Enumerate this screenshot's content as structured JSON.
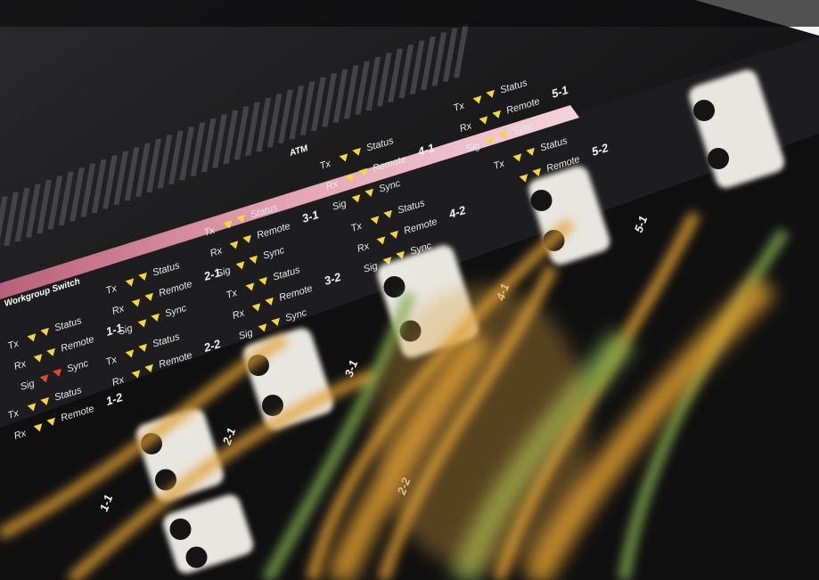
{
  "photo": {
    "subject_labels": {
      "switch_name": "Workgroup Switch",
      "atm": "ATM"
    },
    "port_groups": [
      {
        "id": "1-1",
        "rows": [
          "Status",
          "Remote",
          "Sync"
        ],
        "side": [
          "Tx",
          "Rx",
          "Sig"
        ]
      },
      {
        "id": "1-2",
        "rows": [
          "Status",
          "Remote"
        ],
        "side": [
          "Tx",
          "Rx"
        ]
      },
      {
        "id": "2-1",
        "rows": [
          "Status",
          "Remote",
          "Sync"
        ],
        "side": [
          "Tx",
          "Rx",
          "Sig"
        ]
      },
      {
        "id": "2-2",
        "rows": [
          "Status",
          "Remote"
        ],
        "side": [
          "Tx",
          "Rx"
        ]
      },
      {
        "id": "3-1",
        "rows": [
          "Status",
          "Remote",
          "Sync"
        ],
        "side": [
          "Tx",
          "Rx",
          "Sig"
        ]
      },
      {
        "id": "3-2",
        "rows": [
          "Status",
          "Remote",
          "Sync"
        ],
        "side": [
          "Tx",
          "Rx",
          "Sig"
        ]
      },
      {
        "id": "4-1",
        "rows": [
          "Status",
          "Remote",
          "Sync"
        ],
        "side": [
          "Tx",
          "Rx",
          "Sig"
        ]
      },
      {
        "id": "4-2",
        "rows": [
          "Status",
          "Remote",
          "Sync"
        ],
        "side": [
          "Tx",
          "Rx",
          "Sig"
        ]
      },
      {
        "id": "5-1",
        "rows": [
          "Status",
          "Remote",
          "Sync"
        ],
        "side": [
          "Tx",
          "Rx",
          "Sig"
        ]
      },
      {
        "id": "5-2",
        "rows": [
          "Status",
          "Remote"
        ],
        "side": [
          "Tx"
        ]
      }
    ],
    "port_numbers": [
      "1-1",
      "2-1",
      "2-2",
      "3-1",
      "4-1",
      "5-1"
    ],
    "colors": {
      "panel": "#1c1c1e",
      "pink_stripe": "#d38ea4",
      "led_yellow": "#f5d73a",
      "led_red": "#e04a2c",
      "cable_orange": "#e0a030",
      "cable_green": "#7fa84a",
      "connector_white": "#e8e6e0"
    }
  }
}
